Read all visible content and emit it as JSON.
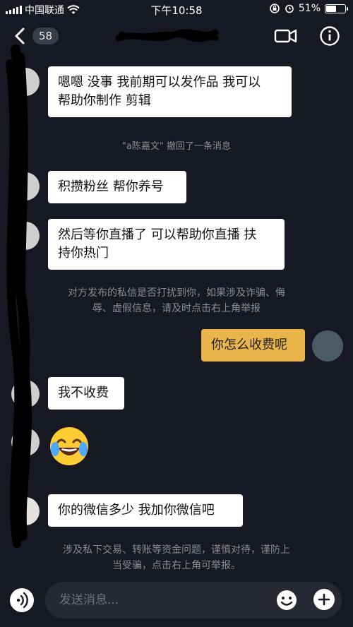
{
  "status_bar": {
    "carrier": "中国联通",
    "time": "下午10:58",
    "battery_text": "51%",
    "battery_level": 0.51
  },
  "nav": {
    "unread_count": "58",
    "icons": [
      "back-arrow-icon",
      "video-camera-icon",
      "info-icon"
    ]
  },
  "messages": [
    {
      "sender": "other",
      "text1": "嗯嗯  没事 我前期可以发作品 我可以",
      "text2": "帮助你制作 剪辑"
    },
    {
      "sender": "system",
      "text": "\"a陈嘉文\" 撤回了一条消息"
    },
    {
      "sender": "other",
      "text": "积攒粉丝 帮你养号"
    },
    {
      "sender": "other",
      "text1": "然后等你直播了 可以帮助你直播 扶",
      "text2": "持你热门"
    },
    {
      "sender": "notice",
      "text1": "对方发布的私信是否打扰到你，如果涉及诈骗、侮",
      "text2": "辱、虚假信息，请及时点击右上角举报"
    },
    {
      "sender": "me",
      "text": "你怎么收费呢"
    },
    {
      "sender": "other",
      "text": "我不收费"
    },
    {
      "sender": "other",
      "emoji": "laughing-crying-face"
    },
    {
      "sender": "other",
      "text": "你的微信多少 我加你微信吧"
    },
    {
      "sender": "notice",
      "text1": "涉及私下交易、转账等资金问题，谨慎对待，谨防上",
      "text2": "当受骗，点击右上角可举报。"
    }
  ],
  "input": {
    "placeholder": "发送消息..."
  },
  "colors": {
    "background": "#161823",
    "my_bubble": "#e9b44a",
    "other_bubble": "#ffffff",
    "hint_text": "#8a8b91"
  }
}
